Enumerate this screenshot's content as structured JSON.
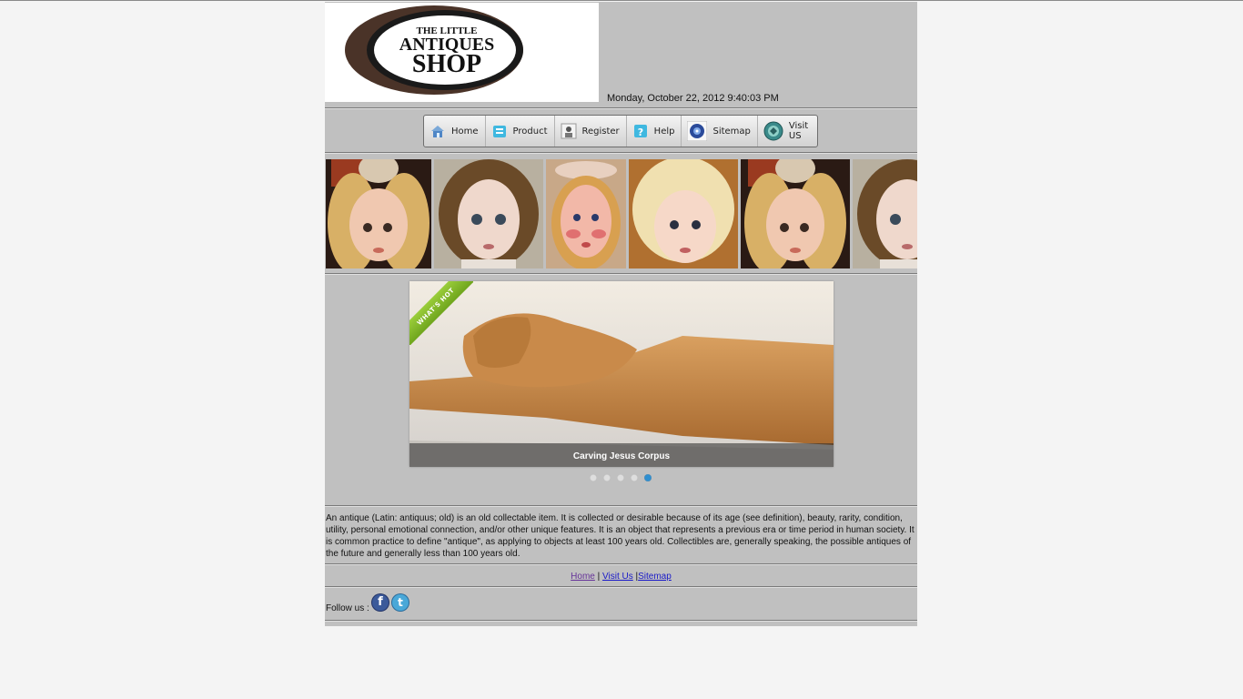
{
  "header": {
    "logo": {
      "line1": "THE LITTLE",
      "line2": "ANTIQUES",
      "line3": "SHOP"
    },
    "datetime": "Monday, October 22, 2012 9:40:03 PM"
  },
  "nav": {
    "items": [
      {
        "label": "Home",
        "icon": "home-icon"
      },
      {
        "label": "Product",
        "icon": "product-icon"
      },
      {
        "label": "Register",
        "icon": "register-icon"
      },
      {
        "label": "Help",
        "icon": "help-icon"
      },
      {
        "label": "Sitemap",
        "icon": "sitemap-icon"
      },
      {
        "label": "Visit US",
        "icon": "visit-icon"
      }
    ]
  },
  "slideshow": {
    "ribbon": "WHAT'S HOT",
    "caption": "Carving Jesus Corpus",
    "dot_count": 5,
    "active_index": 4
  },
  "about": {
    "text": "An antique (Latin: antiquus; old) is an old collectable item. It is collected or desirable because of its age (see definition), beauty, rarity, condition, utility, personal emotional connection, and/or other unique features. It is an object that represents a previous era or time period in human society. It is common practice to define \"antique\", as applying to objects at least 100 years old. Collectibles are, generally speaking, the possible antiques of the future and generally less than 100 years old."
  },
  "footer": {
    "home": "Home",
    "sep1": " | ",
    "visit": "Visit Us",
    "sep2": " |",
    "sitemap": "Sitemap"
  },
  "follow": {
    "label": "Follow us :",
    "facebook": "f",
    "twitter": "t"
  },
  "colors": {
    "page_bg": "#c0c0c0",
    "link": "#1a1ac8",
    "active_dot": "#2f8fd0",
    "ribbon": "#7fb52a"
  }
}
